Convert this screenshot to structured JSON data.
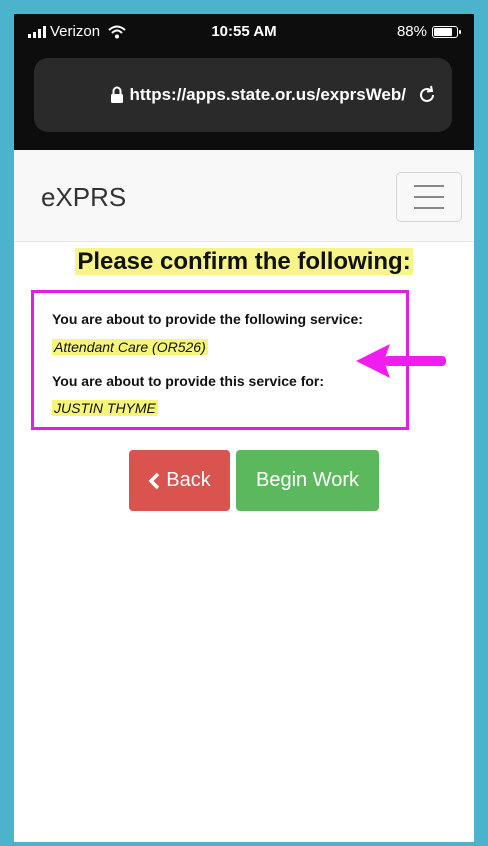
{
  "status_bar": {
    "carrier": "Verizon",
    "time": "10:55 AM",
    "battery": "88%",
    "battery_level": 0.88
  },
  "browser": {
    "url": "https://apps.state.or.us/exprsWeb/"
  },
  "navbar": {
    "brand": "eXPRS"
  },
  "confirm": {
    "heading": "Please confirm the following:",
    "service_label": "You are about to provide the following service:",
    "service_value": "Attendant Care (OR526)",
    "client_label": "You are about to provide this service for:",
    "client_value": "JUSTIN THYME"
  },
  "actions": {
    "back_label": "Back",
    "begin_label": "Begin Work"
  },
  "colors": {
    "frame": "#4bb3cc",
    "highlight_border": "#e020e0",
    "back_button": "#d9534f",
    "begin_button": "#5cb85c",
    "text_highlight": "#f7f48a"
  },
  "icons": {
    "signal": "signal-icon",
    "wifi": "wifi-icon",
    "battery": "battery-icon",
    "lock": "lock-icon",
    "reload": "reload-icon",
    "menu": "hamburger-menu-icon",
    "back": "chevron-left-icon",
    "annotation": "arrow-left-icon"
  }
}
